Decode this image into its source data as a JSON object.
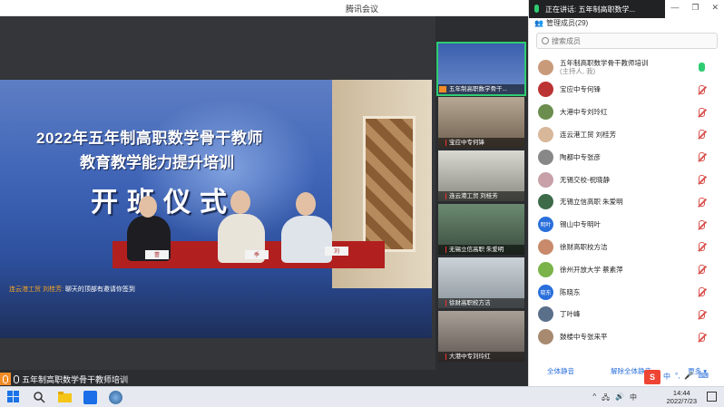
{
  "window": {
    "title": "腾讯会议"
  },
  "main_video": {
    "banner_line1": "2022年五年制高职数学骨干教师",
    "banner_line2": "教育教学能力提升培训",
    "banner_line3": "开班仪式",
    "plates": [
      "蕾",
      "季",
      "刘"
    ]
  },
  "chat_caption": {
    "sender": "连云港工贸 刘桂芳:",
    "text": "聊天的顶部有邀请你签到"
  },
  "speaker_label": "五年制高职数学骨干教师培训",
  "thumbnails": [
    {
      "label": "五年制高职数学骨干..."
    },
    {
      "label": "宝应中专何锋"
    },
    {
      "label": "连云港工贸 刘桂芳"
    },
    {
      "label": "无锡立信高职 朱爱明"
    },
    {
      "label": "徐财高职校方洁"
    },
    {
      "label": "大港中专刘玲红"
    }
  ],
  "panel": {
    "speaking_now": "正在讲话: 五年制高职数学...",
    "members_title": "管理成员(29)",
    "search_placeholder": "搜索成员",
    "members": [
      {
        "name": "五年制高职数学骨干教师培训",
        "sub": "(主持人, 我)",
        "mic": "on",
        "avatar_color": "#c99a7a",
        "avatar_text": ""
      },
      {
        "name": "宝应中专何锋",
        "sub": "",
        "mic": "muted",
        "avatar_color": "#b33",
        "avatar_text": ""
      },
      {
        "name": "大港中专刘玲红",
        "sub": "",
        "mic": "muted",
        "avatar_color": "#6b8e4e",
        "avatar_text": ""
      },
      {
        "name": "连云港工贸 刘桂芳",
        "sub": "",
        "mic": "muted",
        "avatar_color": "#d8b79a",
        "avatar_text": ""
      },
      {
        "name": "陶都中专张彦",
        "sub": "",
        "mic": "muted",
        "avatar_color": "#888",
        "avatar_text": ""
      },
      {
        "name": "无锡交校-祝晓静",
        "sub": "",
        "mic": "muted",
        "avatar_color": "#c7a0a8",
        "avatar_text": ""
      },
      {
        "name": "无锡立信高职  朱爱明",
        "sub": "",
        "mic": "muted",
        "avatar_color": "#3d6b4a",
        "avatar_text": ""
      },
      {
        "name": "锡山中专明叶",
        "sub": "",
        "mic": "muted",
        "avatar_color": "#2a6fdb",
        "avatar_text": "明叶"
      },
      {
        "name": "徐财高职校方洁",
        "sub": "",
        "mic": "muted",
        "avatar_color": "#c88a6a",
        "avatar_text": ""
      },
      {
        "name": "徐州开放大学    蔡素萍",
        "sub": "",
        "mic": "muted",
        "avatar_color": "#7ab34a",
        "avatar_text": ""
      },
      {
        "name": "陈晓东",
        "sub": "",
        "mic": "muted",
        "avatar_color": "#2a6fdb",
        "avatar_text": "晓东"
      },
      {
        "name": "丁叶峰",
        "sub": "",
        "mic": "muted",
        "avatar_color": "#5a6f8a",
        "avatar_text": ""
      },
      {
        "name": "鼓楼中专张来平",
        "sub": "",
        "mic": "muted",
        "avatar_color": "#a88a70",
        "avatar_text": ""
      }
    ],
    "actions": {
      "mute_all": "全体静音",
      "unmute_all": "解除全体静音",
      "more": "更多 ▾"
    }
  },
  "taskbar": {
    "time": "14:44",
    "date": "2022/7/23",
    "tray_ime": "中",
    "sogou": "S"
  },
  "colors": {
    "accent": "#2a6fdb",
    "active_speaker": "#2ecc71",
    "muted": "#d9534f",
    "host_tag": "#f28c28"
  }
}
